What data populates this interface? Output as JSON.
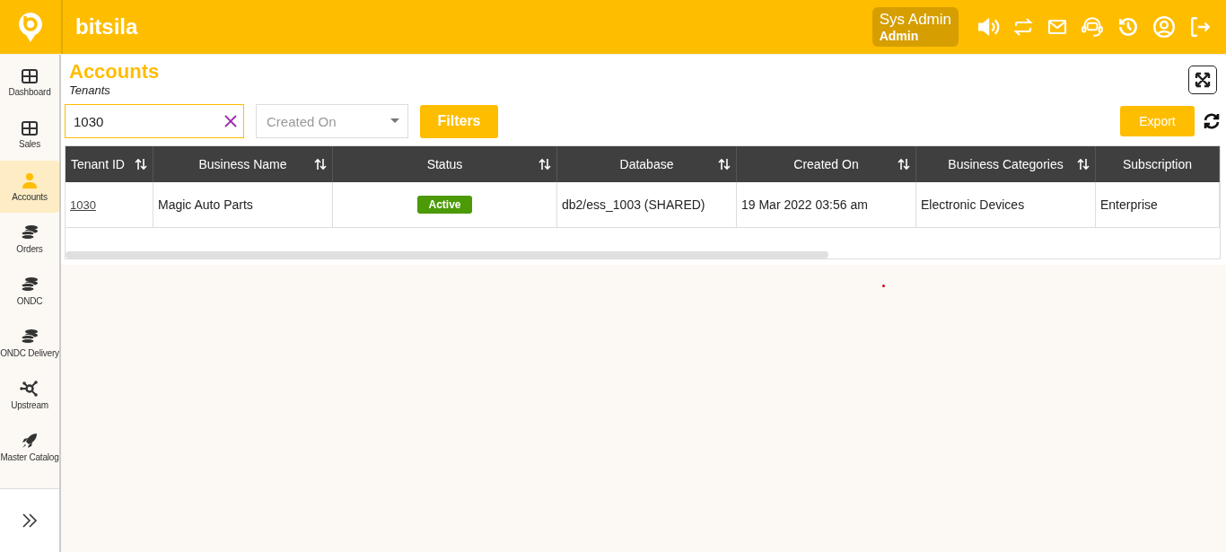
{
  "header": {
    "brand": "bitsila",
    "user": {
      "name": "Sys Admin",
      "role": "Admin"
    }
  },
  "sidebar": {
    "items": [
      {
        "label": "Dashboard",
        "selected": false
      },
      {
        "label": "Sales",
        "selected": false
      },
      {
        "label": "Accounts",
        "selected": true
      },
      {
        "label": "Orders",
        "selected": false
      },
      {
        "label": "ONDC",
        "selected": false
      },
      {
        "label": "ONDC Delivery",
        "selected": false
      },
      {
        "label": "Upstream",
        "selected": false
      },
      {
        "label": "Master Catalog",
        "selected": false
      }
    ]
  },
  "page": {
    "title": "Accounts",
    "subtitle": "Tenants"
  },
  "toolbar": {
    "search": {
      "value": "1030"
    },
    "date_filter": {
      "placeholder": "Created On"
    },
    "filters_button": "Filters",
    "export_button": "Export"
  },
  "table": {
    "columns": [
      {
        "label": "Tenant ID",
        "sortable": true
      },
      {
        "label": "Business Name",
        "sortable": true
      },
      {
        "label": "Status",
        "sortable": true
      },
      {
        "label": "Database",
        "sortable": true
      },
      {
        "label": "Created On",
        "sortable": true
      },
      {
        "label": "Business Categories",
        "sortable": true
      },
      {
        "label": "Subscription",
        "sortable": false
      }
    ],
    "rows": [
      {
        "tenant_id": "1030",
        "business_name": "Magic Auto Parts",
        "status": "Active",
        "database": "db2/ess_1003 (SHARED)",
        "created_on": "19 Mar 2022 03:56 am",
        "business_categories": "Electronic Devices",
        "subscription": "Enterprise"
      }
    ]
  }
}
